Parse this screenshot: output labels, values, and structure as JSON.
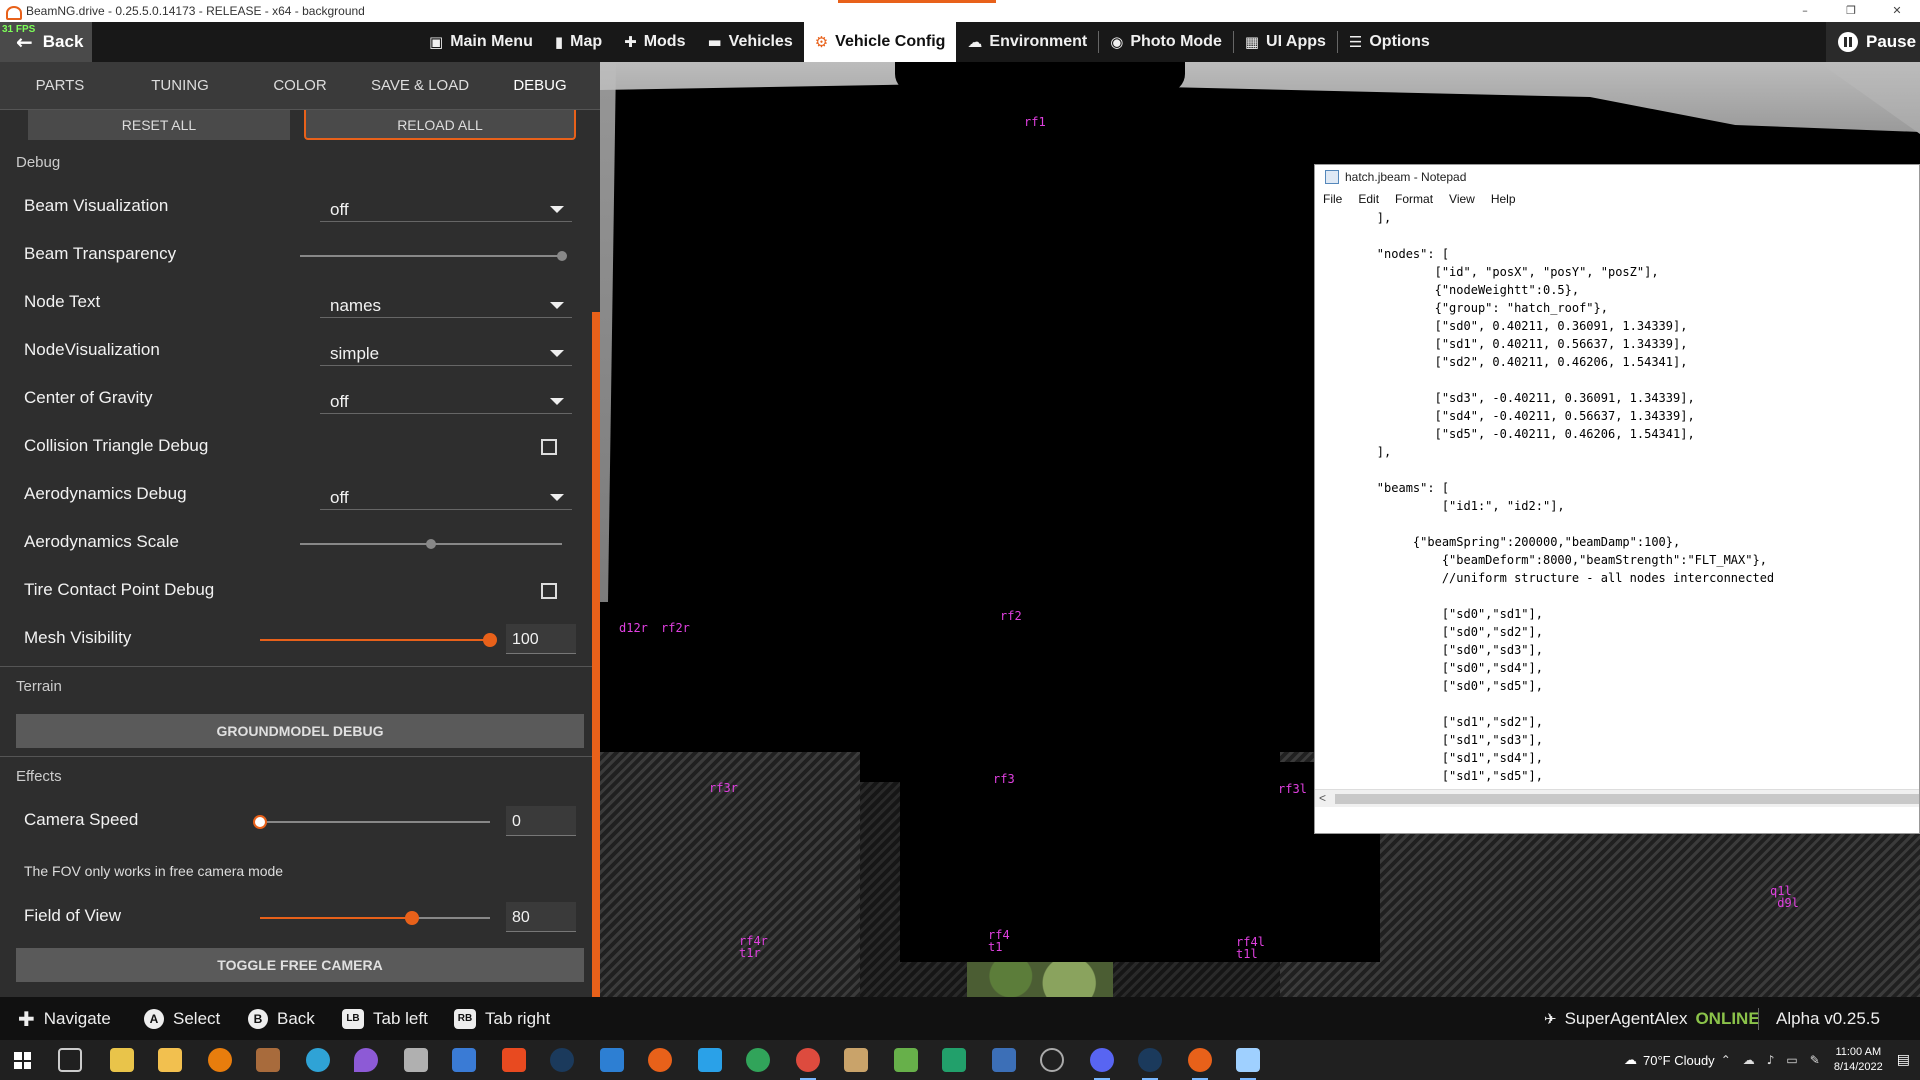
{
  "window": {
    "title": "BeamNG.drive - 0.25.5.0.14173 - RELEASE - x64 - background",
    "minimize": "–",
    "maximize": "❐",
    "close": "✕"
  },
  "topbar": {
    "fps": "31 FPS",
    "back_label": "Back",
    "menu": [
      {
        "label": "Main Menu",
        "icon": "main-menu-icon",
        "glyph": "▣"
      },
      {
        "label": "Map",
        "icon": "map-icon",
        "glyph": "▮"
      },
      {
        "label": "Mods",
        "icon": "mods-icon",
        "glyph": "✚"
      },
      {
        "label": "Vehicles",
        "icon": "car-icon",
        "glyph": "▬"
      },
      {
        "label": "Vehicle Config",
        "icon": "vehicle-config-icon",
        "glyph": "⚙"
      },
      {
        "label": "Environment",
        "icon": "weather-icon",
        "glyph": "☁"
      },
      {
        "label": "Photo Mode",
        "icon": "camera-icon",
        "glyph": "◉"
      },
      {
        "label": "UI Apps",
        "icon": "ui-apps-icon",
        "glyph": "▦"
      },
      {
        "label": "Options",
        "icon": "options-icon",
        "glyph": "☰"
      }
    ],
    "pause_label": "Pause"
  },
  "panel": {
    "tabs": [
      "PARTS",
      "TUNING",
      "COLOR",
      "SAVE & LOAD",
      "DEBUG"
    ],
    "reset_all": "RESET ALL",
    "reload_all": "RELOAD ALL",
    "debug_title": "Debug",
    "beam_visualization": {
      "label": "Beam Visualization",
      "value": "off"
    },
    "beam_transparency": {
      "label": "Beam Transparency",
      "value": 1.0
    },
    "node_text": {
      "label": "Node Text",
      "value": "names"
    },
    "node_visualization": {
      "label": "NodeVisualization",
      "value": "simple"
    },
    "center_of_gravity": {
      "label": "Center of Gravity",
      "value": "off"
    },
    "collision_triangle": {
      "label": "Collision Triangle Debug",
      "checked": false
    },
    "aero_debug": {
      "label": "Aerodynamics Debug",
      "value": "off"
    },
    "aero_scale": {
      "label": "Aerodynamics Scale",
      "value": 0.5
    },
    "tire_contact": {
      "label": "Tire Contact Point Debug",
      "checked": false
    },
    "mesh_visibility": {
      "label": "Mesh Visibility",
      "value": "100",
      "fraction": 1.0
    },
    "terrain_title": "Terrain",
    "groundmodel_debug": "GROUNDMODEL DEBUG",
    "effects_title": "Effects",
    "camera_speed": {
      "label": "Camera Speed",
      "value": "0",
      "fraction": 0.0
    },
    "fov_note": "The FOV only works in free camera mode",
    "field_of_view": {
      "label": "Field of View",
      "value": "80",
      "fraction": 0.8
    },
    "toggle_free_camera": "TOGGLE FREE CAMERA"
  },
  "scene": {
    "node_labels": [
      {
        "name": "rf1",
        "text": "rf1"
      },
      {
        "name": "rf2",
        "text": "rf2"
      },
      {
        "name": "d12r",
        "text": "d12r"
      },
      {
        "name": "rf2r",
        "text": "rf2r"
      },
      {
        "name": "rf3",
        "text": "rf3"
      },
      {
        "name": "rf3r",
        "text": "rf3r"
      },
      {
        "name": "rf3l",
        "text": "rf3l"
      },
      {
        "name": "rf4r",
        "text": "rf4r\nt1r"
      },
      {
        "name": "rf4",
        "text": "rf4\nt1"
      },
      {
        "name": "rf4l",
        "text": "rf4l\nt1l"
      },
      {
        "name": "q1l",
        "text": "q1l\n d9l"
      }
    ]
  },
  "notepad": {
    "title": "hatch.jbeam - Notepad",
    "menu": [
      "File",
      "Edit",
      "Format",
      "View",
      "Help"
    ],
    "lines": [
      "        ],",
      "",
      "        \"nodes\": [",
      "                [\"id\", \"posX\", \"posY\", \"posZ\"],",
      "                {\"nodeWeightt\":0.5},",
      "                {\"group\": \"hatch_roof\"},",
      "                [\"sd0\", 0.40211, 0.36091, 1.34339],",
      "                [\"sd1\", 0.40211, 0.56637, 1.34339],",
      "                [\"sd2\", 0.40211, 0.46206, 1.54341],",
      "",
      "                [\"sd3\", -0.40211, 0.36091, 1.34339],",
      "                [\"sd4\", -0.40211, 0.56637, 1.34339],",
      "                [\"sd5\", -0.40211, 0.46206, 1.54341],",
      "        ],",
      "",
      "        \"beams\": [",
      "                 [\"id1:\", \"id2:\"],",
      "",
      "             {\"beamSpring\":200000,\"beamDamp\":100},",
      "                 {\"beamDeform\":8000,\"beamStrength\":\"FLT_MAX\"},",
      "                 //uniform structure - all nodes interconnected",
      "",
      "                 [\"sd0\",\"sd1\"],",
      "                 [\"sd0\",\"sd2\"],",
      "                 [\"sd0\",\"sd3\"],",
      "                 [\"sd0\",\"sd4\"],",
      "                 [\"sd0\",\"sd5\"],",
      "",
      "                 [\"sd1\",\"sd2\"],",
      "                 [\"sd1\",\"sd3\"],",
      "                 [\"sd1\",\"sd4\"],",
      "                 [\"sd1\",\"sd5\"],"
    ],
    "hscroll_arrow": "<"
  },
  "hints": {
    "navigate": "Navigate",
    "select_badge": "A",
    "select": "Select",
    "back_badge": "B",
    "back": "Back",
    "tab_left_badge": "LB",
    "tab_left": "Tab left",
    "tab_right_badge": "RB",
    "tab_right": "Tab right",
    "user": "SuperAgentAlex",
    "status": "ONLINE",
    "version": "Alpha v0.25.5"
  },
  "taskbar": {
    "weather": "70°F  Cloudy",
    "time": "11:00 AM",
    "date": "8/14/2022"
  },
  "colors": {
    "accent": "#e8611a",
    "online": "#8bc34a",
    "node_label": "#e040e0"
  }
}
